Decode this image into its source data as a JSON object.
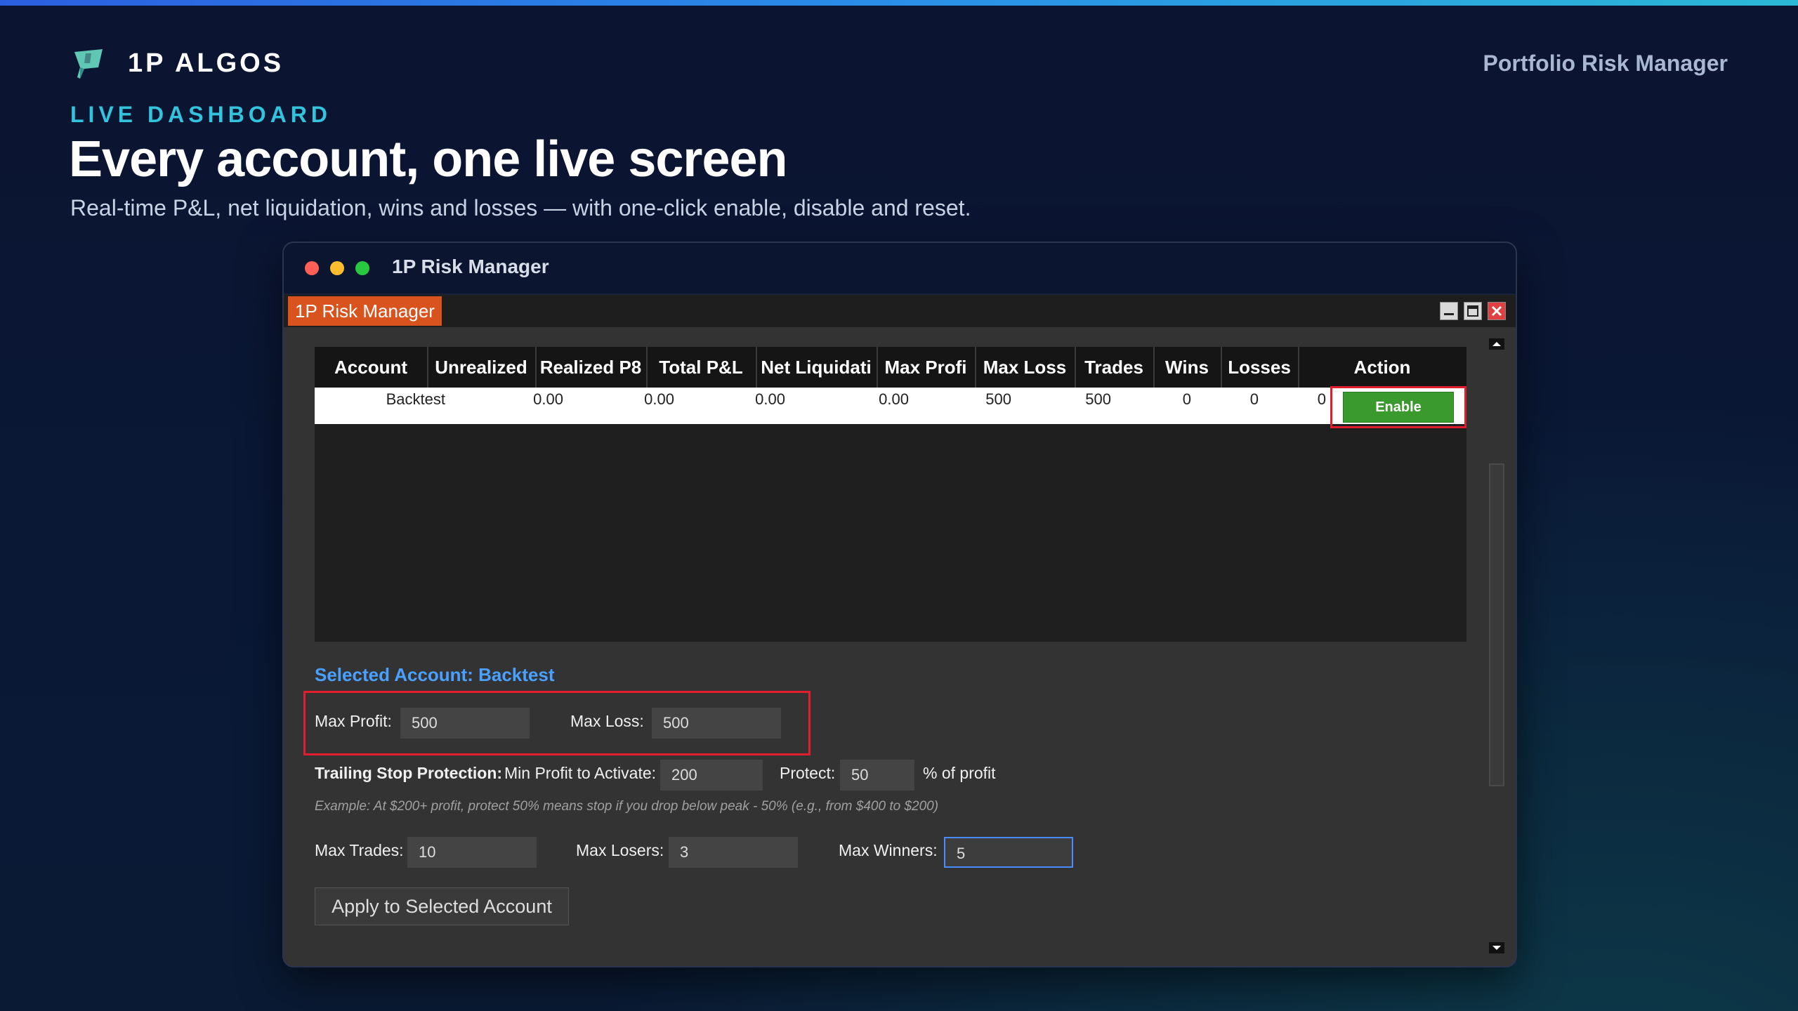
{
  "brand": {
    "name": "1P ALGOS",
    "logo_icon": "leaf-flag-logo"
  },
  "header": {
    "right_label": "Portfolio Risk Manager"
  },
  "hero": {
    "kicker": "LIVE DASHBOARD",
    "title": "Every account, one live screen",
    "subtitle": "Real-time P&L, net liquidation, wins and losses — with one-click enable, disable and reset."
  },
  "window": {
    "title": "1P Risk Manager",
    "inner_tab": "1P Risk Manager",
    "controls": [
      "minimize-icon",
      "maximize-icon",
      "close-icon"
    ]
  },
  "grid": {
    "columns": [
      "Account",
      "Unrealized",
      "Realized P8",
      "Total P&L",
      "Net Liquidati",
      "Max Profi",
      "Max Loss",
      "Trades",
      "Wins",
      "Losses",
      "Action"
    ],
    "rows": [
      {
        "account": "Backtest",
        "unrealized": "0.00",
        "realized": "0.00",
        "total": "0.00",
        "net_liq": "0.00",
        "max_profit": "500",
        "max_loss": "500",
        "trades": "0",
        "wins": "0",
        "losses": "0",
        "action": "Enable"
      }
    ]
  },
  "settings": {
    "selected_title": "Selected Account: Backtest",
    "max_profit_label": "Max Profit:",
    "max_profit_value": "500",
    "max_loss_label": "Max Loss:",
    "max_loss_value": "500",
    "trailing_label": "Trailing Stop Protection:",
    "min_profit_label": "Min Profit to Activate:",
    "min_profit_value": "200",
    "protect_label": "Protect:",
    "protect_value": "50",
    "protect_suffix": "% of profit",
    "example": "Example: At $200+ profit, protect 50% means stop if you drop below peak - 50% (e.g., from $400 to $200)",
    "max_trades_label": "Max Trades:",
    "max_trades_value": "10",
    "max_losers_label": "Max Losers:",
    "max_losers_value": "3",
    "max_winners_label": "Max Winners:",
    "max_winners_value": "5",
    "apply_label": "Apply to Selected Account"
  },
  "colors": {
    "accent_cyan": "#34c3dc",
    "tab_orange": "#d9531e",
    "enable_green": "#3a9a2e",
    "highlight_red": "#e11d2e",
    "selected_blue": "#4aa0ff"
  }
}
